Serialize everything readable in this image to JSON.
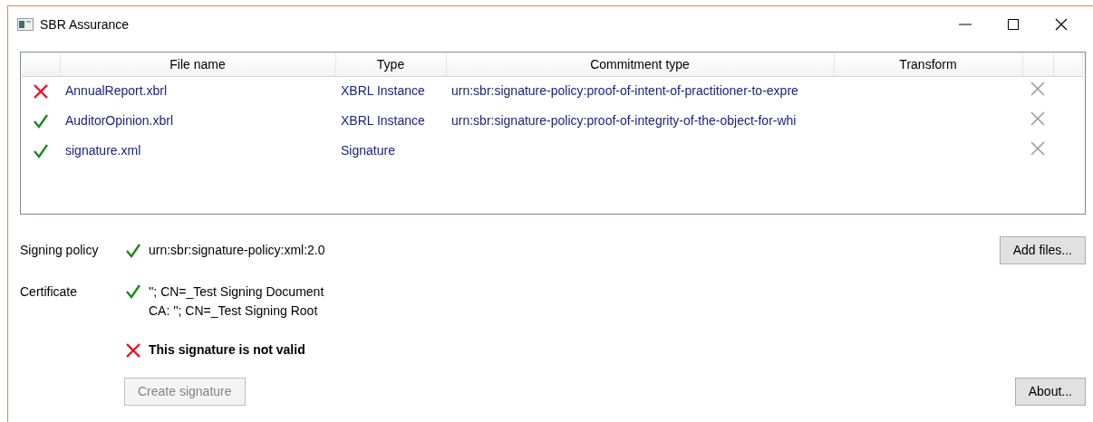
{
  "window": {
    "title": "SBR Assurance"
  },
  "table": {
    "columns": [
      "File name",
      "Type",
      "Commitment type",
      "Transform"
    ],
    "rows": [
      {
        "valid": false,
        "file_name": "AnnualReport.xbrl",
        "type": "XBRL Instance",
        "commitment_type": "urn:sbr:signature-policy:proof-of-intent-of-practitioner-to-expre"
      },
      {
        "valid": true,
        "file_name": "AuditorOpinion.xbrl",
        "type": "XBRL Instance",
        "commitment_type": "urn:sbr:signature-policy:proof-of-integrity-of-the-object-for-whi"
      },
      {
        "valid": true,
        "file_name": "signature.xml",
        "type": "Signature"
      }
    ]
  },
  "signing_policy": {
    "label": "Signing policy",
    "valid": true,
    "value": "urn:sbr:signature-policy:xml:2.0"
  },
  "certificate": {
    "label": "Certificate",
    "valid": true,
    "lines": [
      "''; CN=_Test Signing Document",
      "CA: ''; CN=_Test Signing Root"
    ]
  },
  "result": {
    "valid": false,
    "message": "This signature is not valid"
  },
  "buttons": {
    "add_files": {
      "label": "Add files...",
      "disabled": false
    },
    "create_signature": {
      "label": "Create signature",
      "disabled": true
    },
    "about": {
      "label": "About...",
      "disabled": false
    }
  }
}
